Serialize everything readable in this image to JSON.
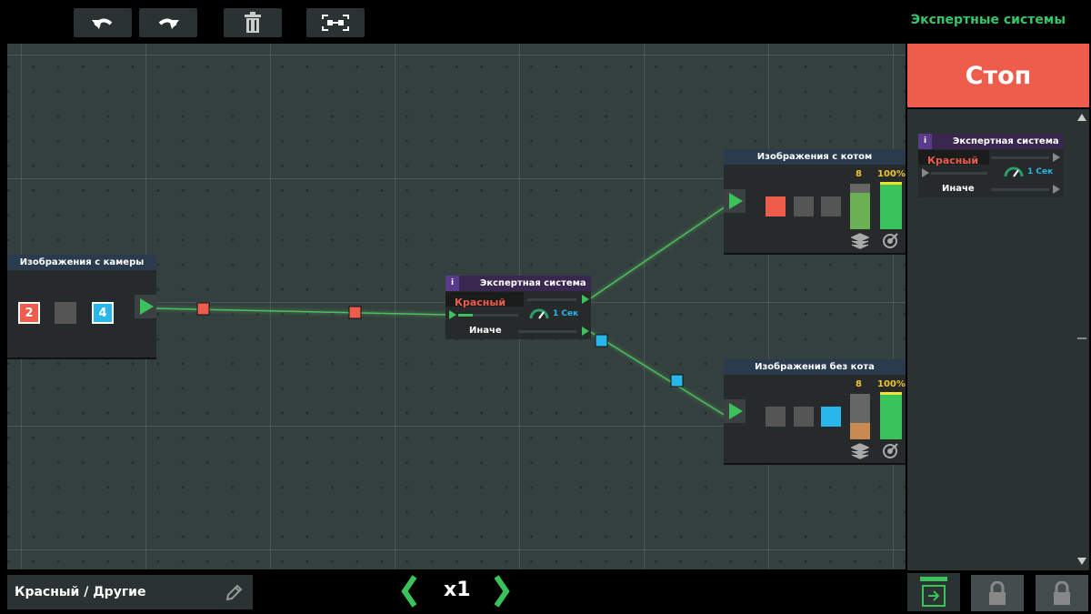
{
  "header": {
    "title": "Экспертные системы"
  },
  "stop_label": "Стоп",
  "camera_node": {
    "title": "Изображения с камеры",
    "tiles": [
      "2",
      "",
      "4"
    ]
  },
  "expert_node": {
    "info": "i",
    "title": "Экспертная система",
    "condition": "Красный",
    "timer": "1 Сек",
    "else_label": "Иначе"
  },
  "cat_node": {
    "title": "Изображения с котом",
    "count": "8",
    "percent": "100%"
  },
  "nocat_node": {
    "title": "Изображения без кота",
    "count": "8",
    "percent": "100%"
  },
  "side_expert": {
    "info": "i",
    "title": "Экспертная система",
    "condition": "Красный",
    "timer": "1 Сек",
    "else_label": "Иначе"
  },
  "footer": {
    "label": "Красный / Другие",
    "speed": "x1"
  },
  "colors": {
    "red": "#ee5c4b",
    "blue": "#29b6e8",
    "green": "#3ac35b",
    "accent": "#38c56a"
  }
}
